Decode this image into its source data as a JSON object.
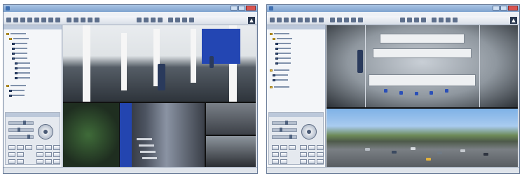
{
  "windows": [
    {
      "title": "",
      "menus": [],
      "logo": "▲",
      "status": "",
      "camera_names": [
        "lobby-panorama",
        "entrance-plants",
        "stairwell",
        "parking-view-1",
        "parking-view-2"
      ]
    },
    {
      "title": "",
      "menus": [],
      "logo": "▲",
      "status": "",
      "camera_names": [
        "office-hemispheric",
        "outdoor-panorama"
      ]
    }
  ],
  "colors": {
    "titlebar": "#7fa3cf",
    "accent_blue_wall": "#2346b3",
    "chair_blue": "#2a4fb8",
    "close_red": "#d9534f"
  },
  "icons": [
    "app-icon",
    "minimize-icon",
    "maximize-icon",
    "close-icon",
    "logo-icon",
    "ptz-joystick-icon",
    "folder-icon",
    "camera-icon"
  ]
}
